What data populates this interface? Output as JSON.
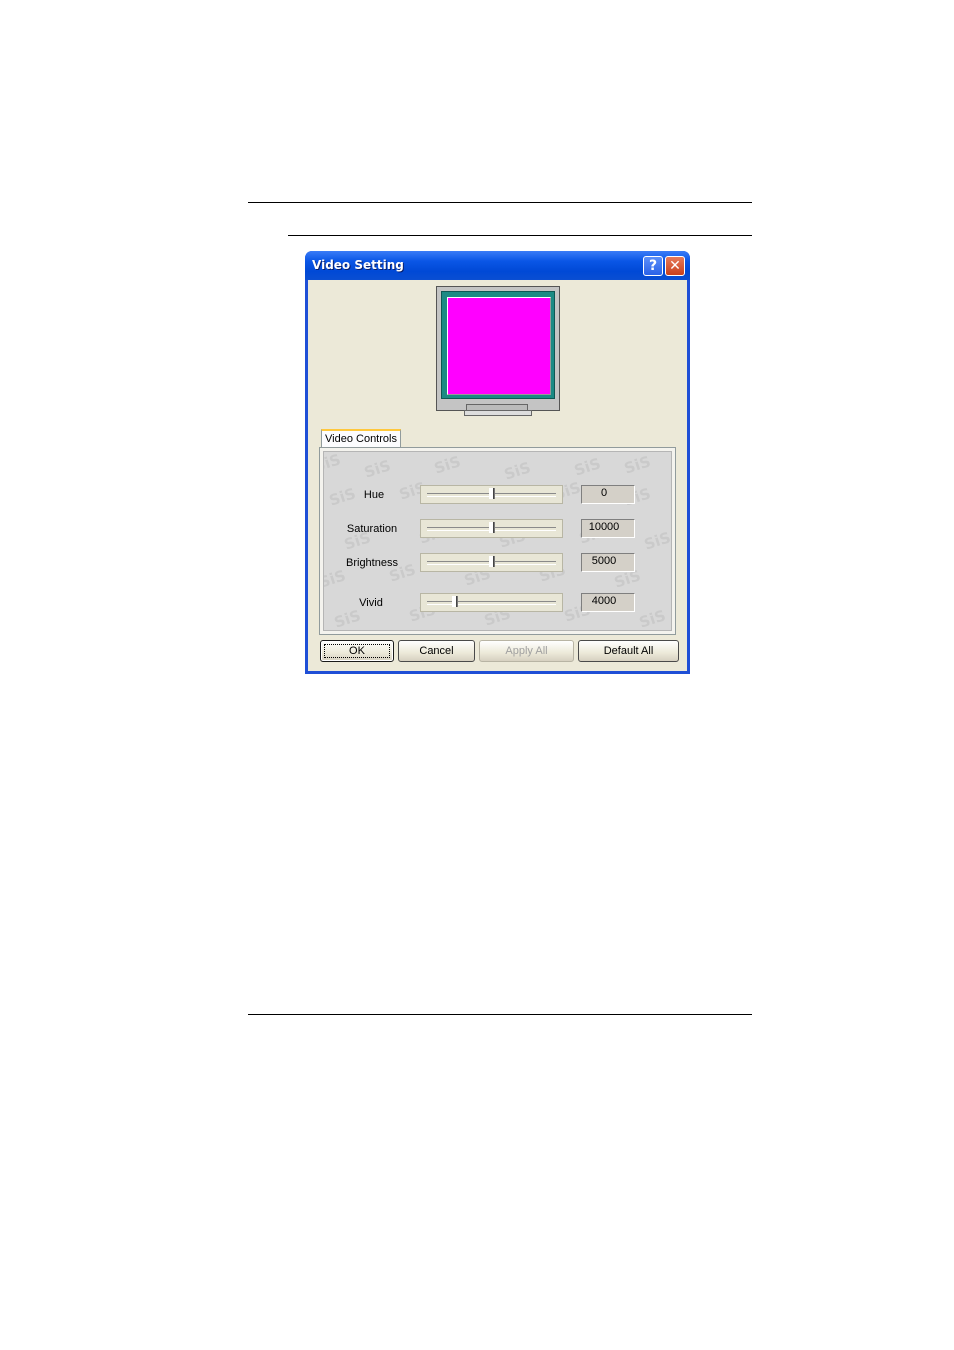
{
  "dialog": {
    "title": "Video Setting",
    "help_glyph": "?",
    "close_glyph": "✕"
  },
  "preview": {
    "screen_color": "#ff00ff"
  },
  "tabs": [
    {
      "label": "Video Controls",
      "selected": true
    }
  ],
  "controls": [
    {
      "label": "Hue",
      "value": "0",
      "slider_fraction": 0.5
    },
    {
      "label": "Saturation",
      "value": "10000",
      "slider_fraction": 0.5
    },
    {
      "label": "Brightness",
      "value": "5000",
      "slider_fraction": 0.5
    },
    {
      "label": "Vivid",
      "value": "4000",
      "slider_fraction": 0.2
    }
  ],
  "watermark_text": "SiS",
  "buttons": {
    "ok": "OK",
    "cancel": "Cancel",
    "apply_all": "Apply All",
    "default_all": "Default All"
  }
}
